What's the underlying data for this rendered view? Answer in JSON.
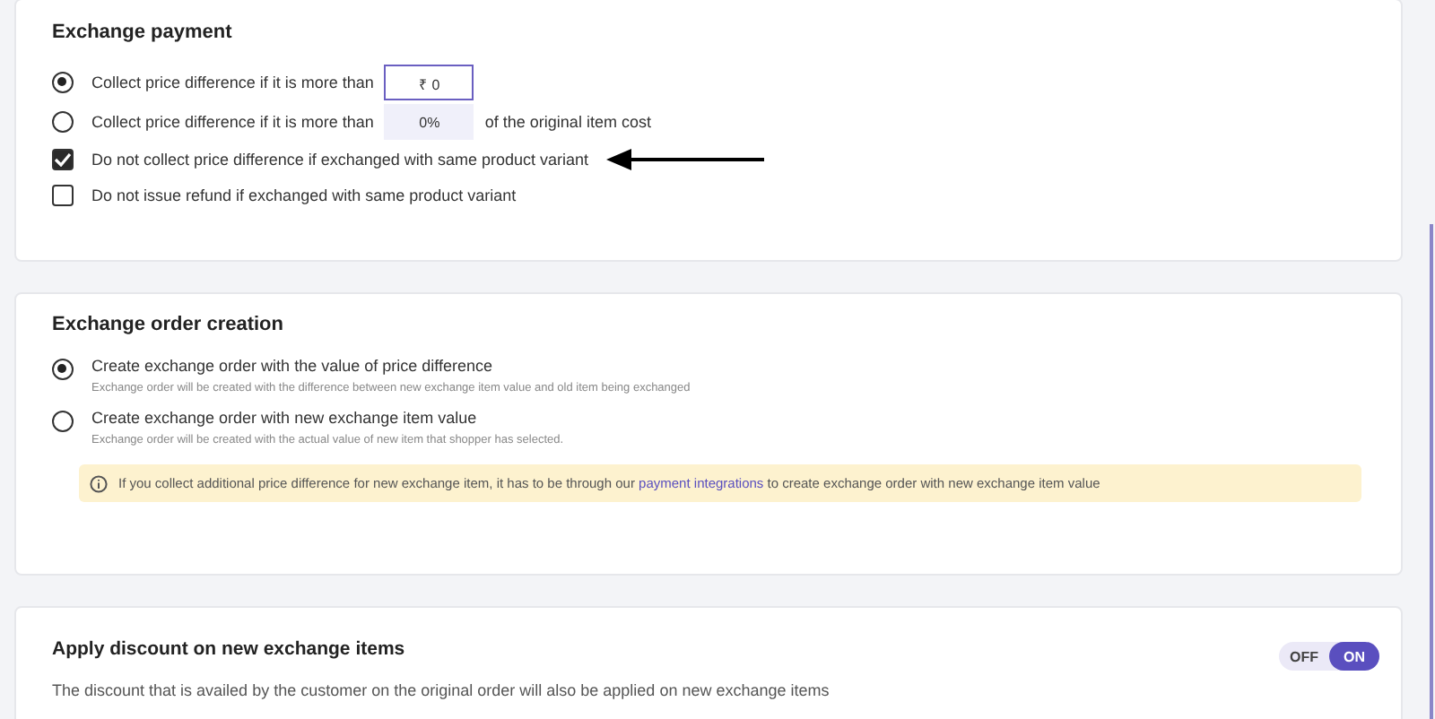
{
  "exchange_payment": {
    "title": "Exchange payment",
    "options": [
      {
        "kind": "radio",
        "selected": true,
        "label": "Collect price difference if it is more than",
        "input_value": "₹ 0"
      },
      {
        "kind": "radio",
        "selected": false,
        "label": "Collect price difference if it is more than",
        "input_value": "0%",
        "suffix": "of the original item cost"
      },
      {
        "kind": "checkbox",
        "checked": true,
        "label": "Do not collect price difference if exchanged with same product variant"
      },
      {
        "kind": "checkbox",
        "checked": false,
        "label": "Do not issue refund if exchanged with same product variant"
      }
    ]
  },
  "exchange_order_creation": {
    "title": "Exchange order creation",
    "options": [
      {
        "selected": true,
        "label": "Create exchange order with the value of price difference",
        "description": "Exchange order will be created with the difference between new exchange item value and old item being exchanged"
      },
      {
        "selected": false,
        "label": "Create exchange order with new exchange item value",
        "description": "Exchange order will be created with the actual value of new item that shopper has selected."
      }
    ],
    "notice": {
      "before": "If you collect additional price difference for new exchange item, it has to be through our",
      "link": "payment integrations",
      "after": "to create exchange order with new exchange item value"
    }
  },
  "apply_discount": {
    "title": "Apply discount on new exchange items",
    "description": "The discount that is availed by the customer on the original order will also be applied on new exchange items",
    "toggle": [
      {
        "label": "OFF",
        "selected": false
      },
      {
        "label": "ON",
        "selected": true
      }
    ]
  }
}
